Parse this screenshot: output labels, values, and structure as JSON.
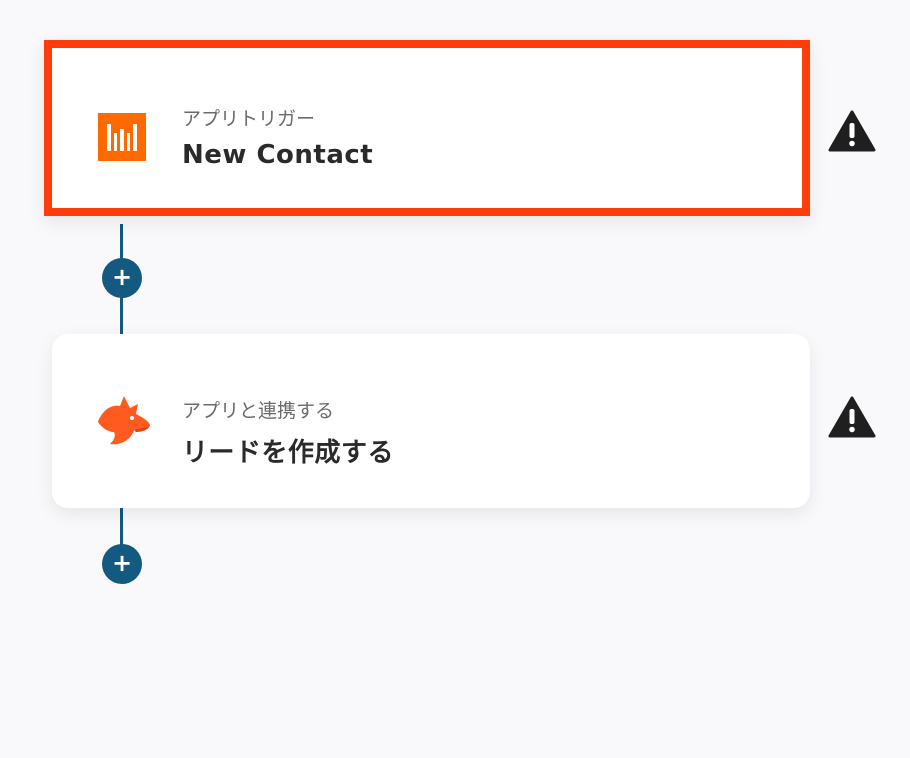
{
  "steps": [
    {
      "subtitle": "アプリトリガー",
      "title": "New Contact",
      "icon": "hubspot-style-orange-bars-icon",
      "warning_icon": "warning-icon",
      "selected": true
    },
    {
      "subtitle": "アプリと連携する",
      "title": "リードを作成する",
      "icon": "fox-icon",
      "warning_icon": "warning-icon",
      "selected": false
    }
  ],
  "add_step_symbol": "+",
  "colors": {
    "selected_border": "#ff3d0a",
    "connector": "#14597f",
    "app_orange": "#ff6a00",
    "fox_orange": "#ff5a1f",
    "warning": "#1f1f1f"
  }
}
